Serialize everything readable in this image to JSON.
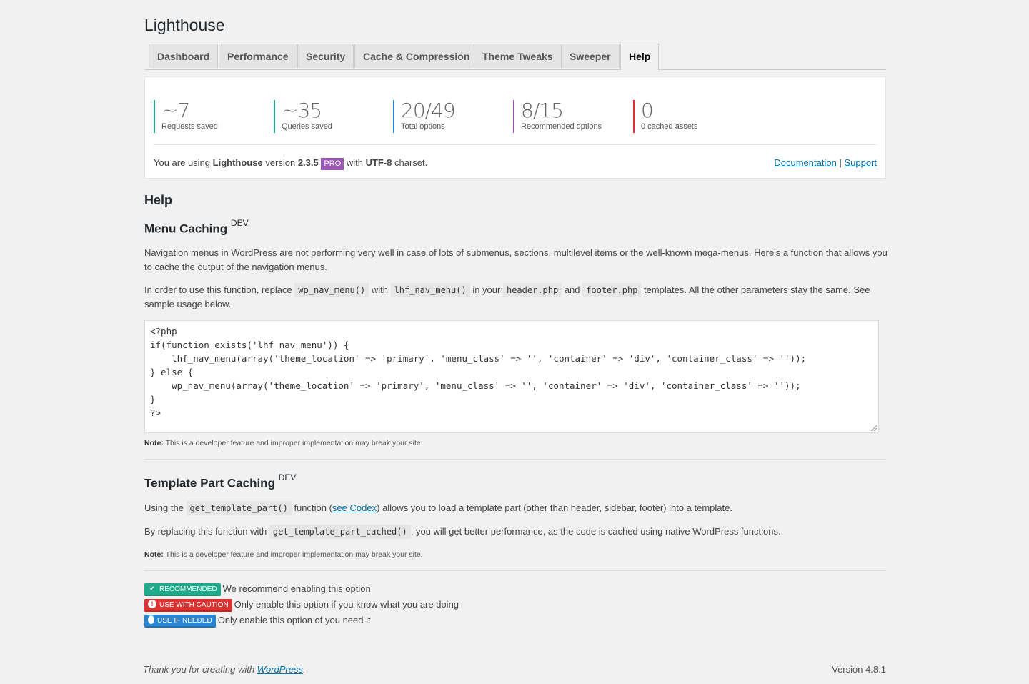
{
  "app": {
    "title": "Lighthouse"
  },
  "tabs": [
    {
      "label": "Dashboard"
    },
    {
      "label": "Performance"
    },
    {
      "label": "Security"
    },
    {
      "label": "Cache & Compression"
    },
    {
      "label": "Theme Tweaks"
    },
    {
      "label": "Sweeper"
    },
    {
      "label": "Help",
      "active": true
    }
  ],
  "stats": [
    {
      "value": "~7",
      "label": "Requests saved",
      "color": "#1fab89"
    },
    {
      "value": "~35",
      "label": "Queries saved",
      "color": "#1fab89"
    },
    {
      "value": "20/49",
      "label": "Total options",
      "color": "#2b85d5"
    },
    {
      "value": "8/15",
      "label": "Recommended options",
      "color": "#9b59b6"
    },
    {
      "value": "0",
      "label": "0 cached assets",
      "color": "#dc3232"
    }
  ],
  "version_info": {
    "prefix": "You are using ",
    "product": "Lighthouse",
    "mid": " version ",
    "version": "2.3.5",
    "badge": "PRO",
    "with": " with ",
    "charset": "UTF-8",
    "suffix": " charset.",
    "badge_color": "#9b59b6"
  },
  "links": {
    "documentation": "Documentation",
    "separator": "|",
    "support": "Support"
  },
  "help_heading": "Help",
  "menu_caching": {
    "title": "Menu Caching",
    "tag": "DEV",
    "para1": "Navigation menus in WordPress are not performing very well in case of lots of submenus, sections, multilevel items or the well-known mega-menus. Here's a function that allows you to cache the output of the navigation menus.",
    "para2_a": "In order to use this function, replace ",
    "code_a": "wp_nav_menu()",
    "para2_b": " with ",
    "code_b": "lhf_nav_menu()",
    "para2_c": " in your ",
    "code_c": "header.php",
    "para2_d": " and ",
    "code_d": "footer.php",
    "para2_e": " templates. All the other parameters stay the same. See sample usage below.",
    "code_sample": "<?php\nif(function_exists('lhf_nav_menu')) {\n    lhf_nav_menu(array('theme_location' => 'primary', 'menu_class' => '', 'container' => 'div', 'container_class' => ''));\n} else {\n    wp_nav_menu(array('theme_location' => 'primary', 'menu_class' => '', 'container' => 'div', 'container_class' => ''));\n}\n?>",
    "note_label": "Note:",
    "note_text": " This is a developer feature and improper implementation may break your site."
  },
  "template_caching": {
    "title": "Template Part Caching",
    "tag": "DEV",
    "p1_a": "Using the ",
    "code_a": "get_template_part()",
    "p1_b": " function (",
    "link": "see Codex",
    "p1_c": ") allows you to load a template part (other than header, sidebar, footer) into a template.",
    "p2_a": "By replacing this function with ",
    "code_b": "get_template_part_cached()",
    "p2_b": ", you will get better performance, as the code is cached using native WordPress functions.",
    "note_label": "Note:",
    "note_text": " This is a developer feature and improper implementation may break your site."
  },
  "legend": [
    {
      "badge": "RECOMMENDED",
      "text": "We recommend enabling this option",
      "icon": "check-icon",
      "color": "#1fab89"
    },
    {
      "badge": "USE WITH CAUTION",
      "text": "Only enable this option if you know what you are doing",
      "icon": "exclamation-icon",
      "color": "#dc3232"
    },
    {
      "badge": "USE IF NEEDED",
      "text": "Only enable this option of you need it",
      "icon": "lightbulb-icon",
      "color": "#2b85d5"
    }
  ],
  "footer": {
    "thanks_prefix": "Thank you for creating with ",
    "wp_link": "WordPress",
    "thanks_suffix": ".",
    "version": "Version 4.8.1"
  }
}
